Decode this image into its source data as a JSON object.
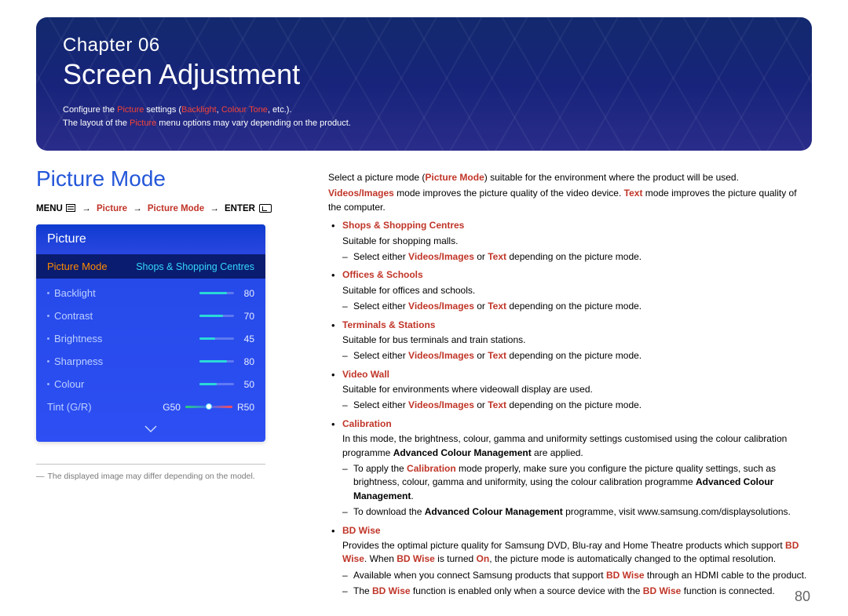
{
  "header": {
    "chapter_label": "Chapter 06",
    "chapter_title": "Screen Adjustment",
    "intro_prefix": "Configure the ",
    "intro_hl1": "Picture",
    "intro_mid": " settings (",
    "intro_hl2": "Backlight",
    "intro_sep": ", ",
    "intro_hl3": "Colour Tone",
    "intro_suffix": ", etc.).",
    "intro_line2_a": "The layout of the ",
    "intro_line2_hl": "Picture",
    "intro_line2_b": " menu options may vary depending on the product."
  },
  "section": {
    "heading": "Picture Mode",
    "nav_menu": "MENU",
    "nav_picture": "Picture",
    "nav_picture_mode": "Picture Mode",
    "nav_enter": "ENTER",
    "arrow": "→"
  },
  "osd": {
    "title": "Picture",
    "mode_label": "Picture Mode",
    "mode_value": "Shops & Shopping Centres",
    "items": [
      {
        "name": "Backlight",
        "value": "80",
        "pct": 80
      },
      {
        "name": "Contrast",
        "value": "70",
        "pct": 70
      },
      {
        "name": "Brightness",
        "value": "45",
        "pct": 45
      },
      {
        "name": "Sharpness",
        "value": "80",
        "pct": 80
      },
      {
        "name": "Colour",
        "value": "50",
        "pct": 50
      }
    ],
    "tint_name": "Tint (G/R)",
    "tint_left": "G50",
    "tint_right": "R50"
  },
  "footnote_left": "The displayed image may differ depending on the model.",
  "body": {
    "p1_a": "Select a picture mode (",
    "p1_hl": "Picture Mode",
    "p1_b": ") suitable for the environment where the product will be used.",
    "p2_hl1": "Videos/Images",
    "p2_a": " mode improves the picture quality of the video device. ",
    "p2_hl2": "Text",
    "p2_b": " mode improves the picture quality of the computer.",
    "items": [
      {
        "title": "Shops & Shopping Centres",
        "desc": "Suitable for shopping malls.",
        "sub_a": "Select either ",
        "sub_hl1": "Videos/Images",
        "sub_or": " or ",
        "sub_hl2": "Text",
        "sub_b": " depending on the picture mode."
      },
      {
        "title": "Offices & Schools",
        "desc": "Suitable for offices and schools.",
        "sub_a": "Select either ",
        "sub_hl1": "Videos/Images",
        "sub_or": " or ",
        "sub_hl2": "Text",
        "sub_b": " depending on the picture mode."
      },
      {
        "title": "Terminals & Stations",
        "desc": "Suitable for bus terminals and train stations.",
        "sub_a": "Select either ",
        "sub_hl1": "Videos/Images",
        "sub_or": " or ",
        "sub_hl2": "Text",
        "sub_b": " depending on the picture mode."
      },
      {
        "title": "Video Wall",
        "desc": "Suitable for environments where videowall display are used.",
        "sub_a": "Select either ",
        "sub_hl1": "Videos/Images",
        "sub_or": " or ",
        "sub_hl2": "Text",
        "sub_b": " depending on the picture mode."
      }
    ],
    "calibration": {
      "title": "Calibration",
      "desc_a": "In this mode, the brightness, colour, gamma and uniformity settings customised using the colour calibration programme ",
      "desc_bold": "Advanced Colour Management",
      "desc_b": " are applied.",
      "sub1_a": "To apply the ",
      "sub1_hl": "Calibration",
      "sub1_b": " mode properly, make sure you configure the picture quality settings, such as brightness, colour, gamma and uniformity, using the colour calibration programme ",
      "sub1_bold": "Advanced Colour Management",
      "sub1_c": ".",
      "sub2_a": "To download the ",
      "sub2_bold": "Advanced Colour Management",
      "sub2_b": " programme, visit www.samsung.com/displaysolutions."
    },
    "bdwise": {
      "title": "BD Wise",
      "desc_a": "Provides the optimal picture quality for Samsung DVD, Blu-ray and Home Theatre products which support ",
      "desc_hl1": "BD Wise",
      "desc_b": ". When ",
      "desc_hl2": "BD Wise",
      "desc_c": " is turned ",
      "desc_hl3": "On",
      "desc_d": ", the picture mode is automatically changed to the optimal resolution.",
      "sub1_a": "Available when you connect Samsung products that support ",
      "sub1_hl": "BD Wise",
      "sub1_b": " through an HDMI cable to the product.",
      "sub2_a": "The ",
      "sub2_hl1": "BD Wise",
      "sub2_b": " function is enabled only when a source device with the ",
      "sub2_hl2": "BD Wise",
      "sub2_c": " function is connected."
    }
  },
  "page_number": "80"
}
